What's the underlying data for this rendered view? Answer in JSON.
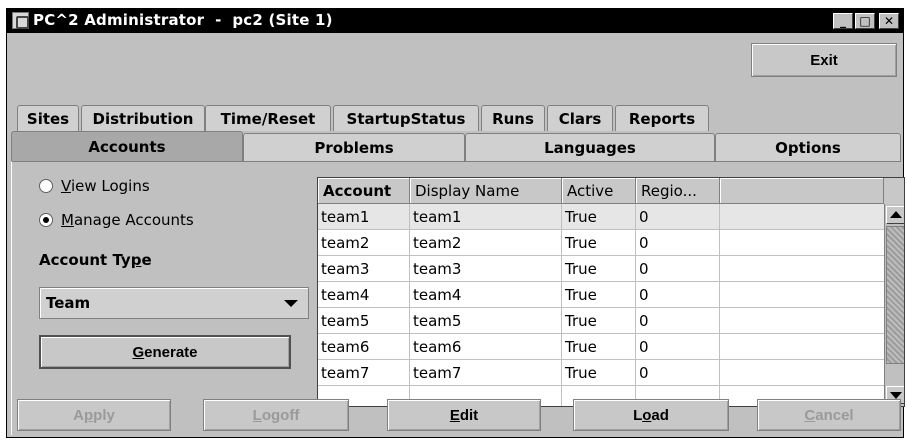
{
  "window": {
    "title": "PC^2 Administrator  -  pc2 (Site 1)",
    "controls": {
      "minimize": "_",
      "maximize": "□",
      "close": "✕"
    }
  },
  "toolbar": {
    "exit_label": "Exit"
  },
  "tabs_row1": [
    "Sites",
    "Distribution",
    "Time/Reset",
    "StartupStatus",
    "Runs",
    "Clars",
    "Reports"
  ],
  "tabs_row2": [
    "Accounts",
    "Problems",
    "Languages",
    "Options"
  ],
  "active_tab": "Accounts",
  "left_panel": {
    "view_logins": {
      "pre": "",
      "mnemonic": "V",
      "post": "iew Logins"
    },
    "manage_accounts": {
      "pre": "",
      "mnemonic": "M",
      "post": "anage Accounts"
    },
    "account_type_label": {
      "pre": "Account Ty",
      "mnemonic": "p",
      "post": "e"
    },
    "account_type_value": "Team",
    "generate": {
      "pre": "",
      "mnemonic": "G",
      "post": "enerate"
    }
  },
  "table": {
    "columns": [
      "Account",
      "Display Name",
      "Active",
      "Regio..."
    ],
    "rows": [
      [
        "team1",
        "team1",
        "True",
        "0"
      ],
      [
        "team2",
        "team2",
        "True",
        "0"
      ],
      [
        "team3",
        "team3",
        "True",
        "0"
      ],
      [
        "team4",
        "team4",
        "True",
        "0"
      ],
      [
        "team5",
        "team5",
        "True",
        "0"
      ],
      [
        "team6",
        "team6",
        "True",
        "0"
      ],
      [
        "team7",
        "team7",
        "True",
        "0"
      ]
    ]
  },
  "footer": {
    "apply": {
      "pre": "A",
      "mnemonic": "p",
      "post": "ply"
    },
    "logoff": {
      "pre": "",
      "mnemonic": "L",
      "post": "ogoff"
    },
    "edit": {
      "pre": "",
      "mnemonic": "E",
      "post": "dit"
    },
    "load": {
      "pre": "L",
      "mnemonic": "o",
      "post": "ad"
    },
    "cancel": {
      "pre": "",
      "mnemonic": "C",
      "post": "ancel"
    }
  }
}
